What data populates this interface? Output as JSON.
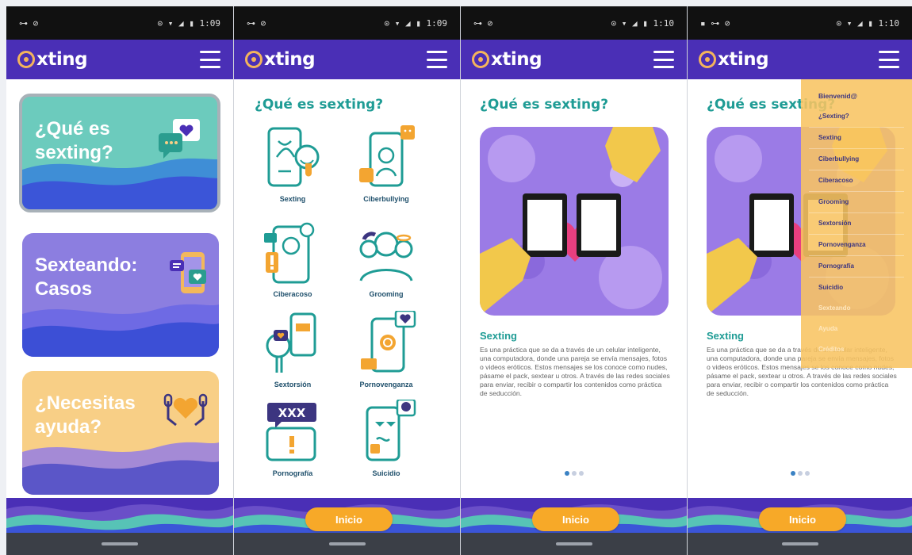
{
  "screens": [
    {
      "status": {
        "left": "⊶ ⊘",
        "right": "⊙ ▾ ◢ ▮ 1:09"
      },
      "app": {
        "logo_text": "xting"
      },
      "cards": [
        {
          "title_line1": "¿Qué es",
          "title_line2": "sexting?",
          "color": "#6ccbbd",
          "icon": "chat-heart-icon"
        },
        {
          "title_line1": "Sexteando:",
          "title_line2": "Casos",
          "color": "#8c7ee0",
          "icon": "phone-chat-icon"
        },
        {
          "title_line1": "¿Necesitas",
          "title_line2": "ayuda?",
          "color": "#f8cf86",
          "icon": "hands-heart-icon"
        }
      ]
    },
    {
      "status": {
        "left": "⊶ ⊘",
        "right": "⊙ ▾ ◢ ▮ 1:09"
      },
      "app": {
        "logo_text": "xting"
      },
      "title": "¿Qué es sexting?",
      "grid": [
        {
          "label": "Sexting",
          "icon": "phone-face-icon"
        },
        {
          "label": "Ciberbullying",
          "icon": "phone-bully-icon"
        },
        {
          "label": "Ciberacoso",
          "icon": "stalker-icon"
        },
        {
          "label": "Grooming",
          "icon": "group-icon"
        },
        {
          "label": "Sextorsión",
          "icon": "extortion-icon"
        },
        {
          "label": "Pornovenganza",
          "icon": "phone-heartbreak-icon"
        },
        {
          "label": "Pornografía",
          "icon": "xxx-phone-icon"
        },
        {
          "label": "Suicidio",
          "icon": "skull-phone-icon"
        }
      ],
      "button": "Inicio"
    },
    {
      "status": {
        "left": "⊶ ⊘",
        "right": "⊙ ▾ ◢ ▮ 1:10"
      },
      "app": {
        "logo_text": "xting"
      },
      "title": "¿Qué es sexting?",
      "heading": "Sexting",
      "text": "Es una práctica que se da a través de un celular inteligente, una computadora, donde una pareja se envía mensajes, fotos o videos eróticos. Estos mensajes se los conoce como nudes, pásame el pack, sextear u otros. A través de las redes sociales para enviar, recibir o compartir los contenidos como práctica de seducción.",
      "button": "Inicio"
    },
    {
      "status": {
        "left": "▪ ⊶ ⊘",
        "right": "⊙ ▾ ◢ ▮ 1:10"
      },
      "app": {
        "logo_text": "xting"
      },
      "title": "¿Qué es sexting?",
      "heading": "Sexting",
      "text": "Es una práctica que se da a través de un celular inteligente, una computadora, donde una pareja se envía mensajes, fotos o videos eróticos. Estos mensajes se los conoce como nudes, pásame el pack, sextear u otros. A través de las redes sociales para enviar, recibir o compartir los contenidos como práctica de seducción.",
      "button": "Inicio",
      "drawer": [
        "Bienvenid@",
        "¿Sexting?",
        "Sexting",
        "Ciberbullying",
        "Ciberacoso",
        "Grooming",
        "Sextorsión",
        "Pornovenganza",
        "Pornografía",
        "Suicidio",
        "Sexteando",
        "Ayuda",
        "Créditos"
      ]
    }
  ],
  "colors": {
    "appbar": "#4a2fb6",
    "accent": "#1f9c95",
    "button": "#f7a928"
  }
}
